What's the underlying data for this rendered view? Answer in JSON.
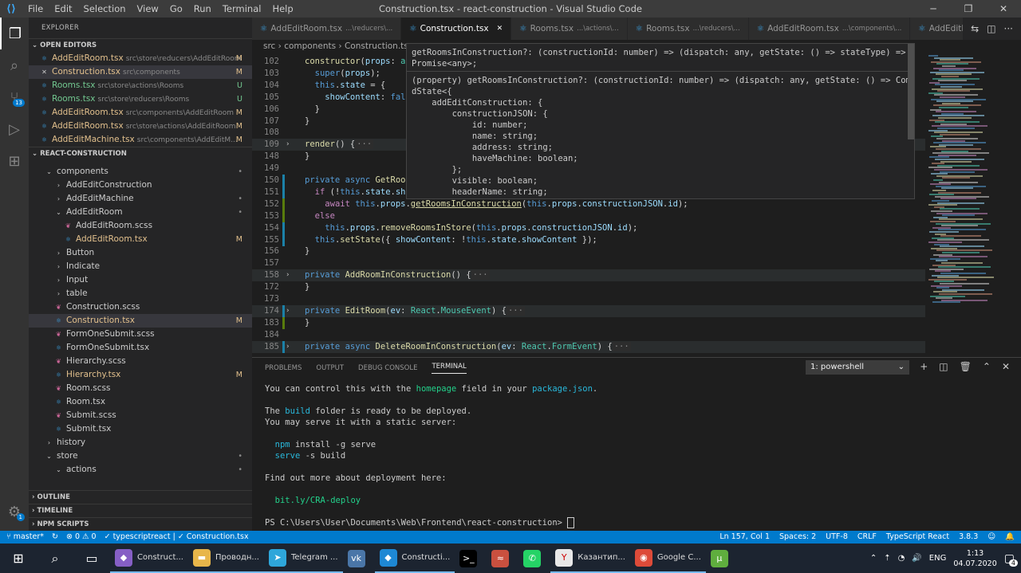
{
  "titlebar": {
    "menu": [
      "File",
      "Edit",
      "Selection",
      "View",
      "Go",
      "Run",
      "Terminal",
      "Help"
    ],
    "title": "Construction.tsx - react-construction - Visual Studio Code"
  },
  "sidebar": {
    "header": "EXPLORER",
    "open_editors_title": "OPEN EDITORS",
    "open_editors": [
      {
        "name": "AddEditRoom.tsx",
        "path": "src\\store\\reducers\\AddEditRoom",
        "status": "M"
      },
      {
        "name": "Construction.tsx",
        "path": "src\\components",
        "status": "M"
      },
      {
        "name": "Rooms.tsx",
        "path": "src\\store\\actions\\Rooms",
        "status": "U"
      },
      {
        "name": "Rooms.tsx",
        "path": "src\\store\\reducers\\Rooms",
        "status": "U"
      },
      {
        "name": "AddEditRoom.tsx",
        "path": "src\\components\\AddEditRoom",
        "status": "M"
      },
      {
        "name": "AddEditRoom.tsx",
        "path": "src\\store\\actions\\AddEditRoom",
        "status": "M"
      },
      {
        "name": "AddEditMachine.tsx",
        "path": "src\\components\\AddEditM...",
        "status": "M"
      }
    ],
    "project_title": "REACT-CONSTRUCTION",
    "tree": [
      {
        "name": "components",
        "kind": "folder-open",
        "indent": 1,
        "status": "•"
      },
      {
        "name": "AddEditConstruction",
        "kind": "folder",
        "indent": 2,
        "status": ""
      },
      {
        "name": "AddEditMachine",
        "kind": "folder",
        "indent": 2,
        "status": "•"
      },
      {
        "name": "AddEditRoom",
        "kind": "folder-open",
        "indent": 2,
        "status": "•"
      },
      {
        "name": "AddEditRoom.scss",
        "kind": "scss",
        "indent": 3,
        "status": ""
      },
      {
        "name": "AddEditRoom.tsx",
        "kind": "ts",
        "indent": 3,
        "status": "M"
      },
      {
        "name": "Button",
        "kind": "folder",
        "indent": 2,
        "status": ""
      },
      {
        "name": "Indicate",
        "kind": "folder",
        "indent": 2,
        "status": ""
      },
      {
        "name": "Input",
        "kind": "folder",
        "indent": 2,
        "status": ""
      },
      {
        "name": "table",
        "kind": "folder",
        "indent": 2,
        "status": ""
      },
      {
        "name": "Construction.scss",
        "kind": "scss",
        "indent": 2,
        "status": ""
      },
      {
        "name": "Construction.tsx",
        "kind": "ts",
        "indent": 2,
        "status": "M"
      },
      {
        "name": "FormOneSubmit.scss",
        "kind": "scss",
        "indent": 2,
        "status": ""
      },
      {
        "name": "FormOneSubmit.tsx",
        "kind": "ts",
        "indent": 2,
        "status": ""
      },
      {
        "name": "Hierarchy.scss",
        "kind": "scss",
        "indent": 2,
        "status": ""
      },
      {
        "name": "Hierarchy.tsx",
        "kind": "ts",
        "indent": 2,
        "status": "M"
      },
      {
        "name": "Room.scss",
        "kind": "scss",
        "indent": 2,
        "status": ""
      },
      {
        "name": "Room.tsx",
        "kind": "ts",
        "indent": 2,
        "status": ""
      },
      {
        "name": "Submit.scss",
        "kind": "scss",
        "indent": 2,
        "status": ""
      },
      {
        "name": "Submit.tsx",
        "kind": "ts",
        "indent": 2,
        "status": ""
      },
      {
        "name": "history",
        "kind": "folder",
        "indent": 1,
        "status": ""
      },
      {
        "name": "store",
        "kind": "folder-open",
        "indent": 1,
        "status": "•"
      },
      {
        "name": "actions",
        "kind": "folder-open",
        "indent": 2,
        "status": "•"
      }
    ],
    "bottom_sections": [
      "OUTLINE",
      "TIMELINE",
      "NPM SCRIPTS"
    ]
  },
  "tabs": [
    {
      "name": "AddEditRoom.tsx",
      "path": "...\\reducers\\...",
      "active": false
    },
    {
      "name": "Construction.tsx",
      "path": "",
      "active": true
    },
    {
      "name": "Rooms.tsx",
      "path": "...\\actions\\...",
      "active": false
    },
    {
      "name": "Rooms.tsx",
      "path": "...\\reducers\\...",
      "active": false
    },
    {
      "name": "AddEditRoom.tsx",
      "path": "...\\components\\...",
      "active": false
    },
    {
      "name": "AddEditRoo",
      "path": "",
      "active": false
    }
  ],
  "breadcrumbs": [
    "src",
    "components",
    "Construction.ts"
  ],
  "code_lines": [
    {
      "n": "102",
      "html": "<span class='fn'>constructor</span><span class='pu'>(</span><span class='pr'>props</span><span class='pu'>: </span><span class='ty'>an</span>",
      "fold": "",
      "g": ""
    },
    {
      "n": "103",
      "html": "  <span class='kw'>super</span><span class='pu'>(</span><span class='pr'>props</span><span class='pu'>);</span>",
      "fold": "",
      "g": ""
    },
    {
      "n": "104",
      "html": "  <span class='kw'>this</span><span class='pu'>.</span><span class='pr'>state</span><span class='pu'> = {</span>",
      "fold": "",
      "g": ""
    },
    {
      "n": "105",
      "html": "    <span class='pr'>showContent</span><span class='pu'>: </span><span class='kw'>fals</span>",
      "fold": "",
      "g": ""
    },
    {
      "n": "106",
      "html": "  <span class='pu'>}</span>",
      "fold": "",
      "g": ""
    },
    {
      "n": "107",
      "html": "<span class='pu'>}</span>",
      "fold": "",
      "g": ""
    },
    {
      "n": "108",
      "html": "",
      "fold": "",
      "g": ""
    },
    {
      "n": "109",
      "html": "<span class='fn'>render</span><span class='pu'>() {</span><span class='foldbox'>···</span>",
      "fold": "›",
      "g": "",
      "hl": true
    },
    {
      "n": "148",
      "html": "<span class='pu'>}</span>",
      "fold": "",
      "g": ""
    },
    {
      "n": "149",
      "html": "",
      "fold": "",
      "g": ""
    },
    {
      "n": "150",
      "html": "<span class='kw'>private</span> <span class='kw'>async</span> <span class='fn'>GetRoom</span>",
      "fold": "",
      "g": "#1b81a8"
    },
    {
      "n": "151",
      "html": "  <span class='ctl'>if</span> <span class='pu'>(!</span><span class='kw'>this</span><span class='pu'>.</span><span class='pr'>state</span><span class='pu'>.</span><span class='pr'>sho</span>",
      "fold": "",
      "g": "#1b81a8"
    },
    {
      "n": "152",
      "html": "    <span class='ctl'>await</span> <span class='kw'>this</span><span class='pu'>.</span><span class='pr'>props</span><span class='pu'>.</span><span class='fn' style='text-decoration:underline'>getRoomsInConstruction</span><span class='pu'>(</span><span class='kw'>this</span><span class='pu'>.</span><span class='pr'>props</span><span class='pu'>.</span><span class='pr'>constructionJSON</span><span class='pu'>.</span><span class='pr'>id</span><span class='pu'>);</span>",
      "fold": "",
      "g": "#587c0c"
    },
    {
      "n": "153",
      "html": "  <span class='ctl'>else</span>",
      "fold": "",
      "g": "#587c0c"
    },
    {
      "n": "154",
      "html": "    <span class='kw'>this</span><span class='pu'>.</span><span class='pr'>props</span><span class='pu'>.</span><span class='fn'>removeRoomsInStore</span><span class='pu'>(</span><span class='kw'>this</span><span class='pu'>.</span><span class='pr'>props</span><span class='pu'>.</span><span class='pr'>constructionJSON</span><span class='pu'>.</span><span class='pr'>id</span><span class='pu'>);</span>",
      "fold": "",
      "g": "#1b81a8"
    },
    {
      "n": "155",
      "html": "  <span class='kw'>this</span><span class='pu'>.</span><span class='fn'>setState</span><span class='pu'>({ </span><span class='pr'>showContent</span><span class='pu'>: !</span><span class='kw'>this</span><span class='pu'>.</span><span class='pr'>state</span><span class='pu'>.</span><span class='pr'>showContent</span><span class='pu'> });</span>",
      "fold": "",
      "g": "#1b81a8"
    },
    {
      "n": "156",
      "html": "<span class='pu'>}</span>",
      "fold": "",
      "g": ""
    },
    {
      "n": "157",
      "html": "",
      "fold": "",
      "g": ""
    },
    {
      "n": "158",
      "html": "<span class='kw'>private</span> <span class='fn'>AddRoomInConstruction</span><span class='pu'>() {</span><span class='foldbox'>···</span>",
      "fold": "›",
      "g": "",
      "hl": true
    },
    {
      "n": "172",
      "html": "<span class='pu'>}</span>",
      "fold": "",
      "g": ""
    },
    {
      "n": "173",
      "html": "",
      "fold": "",
      "g": ""
    },
    {
      "n": "174",
      "html": "<span class='kw'>private</span> <span class='fn'>EditRoom</span><span class='pu'>(</span><span class='pr'>ev</span><span class='pu'>: </span><span class='ty'>React</span><span class='pu'>.</span><span class='ty'>MouseEvent</span><span class='pu'>) {</span><span class='foldbox'>···</span>",
      "fold": "›",
      "g": "#1b81a8",
      "hl": true
    },
    {
      "n": "183",
      "html": "<span class='pu'>}</span>",
      "fold": "",
      "g": "#587c0c"
    },
    {
      "n": "184",
      "html": "",
      "fold": "",
      "g": ""
    },
    {
      "n": "185",
      "html": "<span class='kw'>private</span> <span class='kw'>async</span> <span class='fn'>DeleteRoomInConstruction</span><span class='pu'>(</span><span class='pr'>ev</span><span class='pu'>: </span><span class='ty'>React</span><span class='pu'>.</span><span class='ty'>FormEvent</span><span class='pu'>) {</span><span class='foldbox'>···</span>",
      "fold": "›",
      "g": "#1b81a8",
      "hl": true
    }
  ],
  "hover": {
    "signature": "getRoomsInConstruction?: (constructionId: number) => (dispatch: any, getState: () => stateType) => Promise<any>;",
    "doc": "(property) getRoomsInConstruction?: (constructionId: number) => (dispatch: any, getState: () => Combine\ndState<{\n    addEditConstruction: {\n        constructionJSON: {\n            id: number;\n            name: string;\n            address: string;\n            haveMachine: boolean;\n        };\n        visible: boolean;\n        headerName: string;"
  },
  "panel": {
    "tabs": [
      "PROBLEMS",
      "OUTPUT",
      "DEBUG CONSOLE",
      "TERMINAL"
    ],
    "active_tab": "TERMINAL",
    "terminal_select": "1: powershell"
  },
  "terminal_lines": [
    {
      "html": "You can control this with the <span class='tg'>homepage</span> field in your <span class='tc'>package.json</span>."
    },
    {
      "html": ""
    },
    {
      "html": "The <span class='tc'>build</span> folder is ready to be deployed."
    },
    {
      "html": "You may serve it with a static server:"
    },
    {
      "html": ""
    },
    {
      "html": "  <span class='tc'>npm</span> install -g serve"
    },
    {
      "html": "  <span class='tc'>serve</span> -s build"
    },
    {
      "html": ""
    },
    {
      "html": "Find out more about deployment here:"
    },
    {
      "html": ""
    },
    {
      "html": "  <span class='tg'>bit.ly/CRA-deploy</span>"
    },
    {
      "html": ""
    },
    {
      "html": "PS C:\\Users\\User\\Documents\\Web\\Frontend\\react-construction> <span style='border:1px solid #ccc'>&nbsp;</span>"
    }
  ],
  "statusbar": {
    "branch": "master*",
    "sync": "↻",
    "errors": "⊗ 0 ⚠ 0",
    "lang_ver": "✓ typescriptreact | ✓ Construction.tsx",
    "position": "Ln 157, Col 1",
    "spaces": "Spaces: 2",
    "encoding": "UTF-8",
    "eol": "CRLF",
    "language": "TypeScript React",
    "ts_version": "3.8.3"
  },
  "taskbar": {
    "apps": [
      {
        "label": "Construct...",
        "color": "#865fc5",
        "glyph": "◆",
        "open": true
      },
      {
        "label": "Проводн...",
        "color": "#e8b64a",
        "glyph": "▬",
        "open": true
      },
      {
        "label": "Telegram ...",
        "color": "#2ea6da",
        "glyph": "➤",
        "open": true
      },
      {
        "label": "",
        "color": "#4a76a8",
        "glyph": "vk",
        "open": false
      },
      {
        "label": "Constructi...",
        "color": "#1e88d4",
        "glyph": "◆",
        "open": true
      },
      {
        "label": "",
        "color": "#000000",
        "glyph": ">_",
        "open": false
      },
      {
        "label": "",
        "color": "#c9503f",
        "glyph": "≈",
        "open": false
      },
      {
        "label": "",
        "color": "#25d366",
        "glyph": "✆",
        "open": false
      },
      {
        "label": "Казантип...",
        "color": "#e8e8e8",
        "glyph": "Y",
        "open": true
      },
      {
        "label": "Google C...",
        "color": "#dd4b39",
        "glyph": "◉",
        "open": true
      },
      {
        "label": "",
        "color": "#5fae3e",
        "glyph": "µ",
        "open": false
      }
    ],
    "tray_lang": "ENG",
    "time": "1:13",
    "date": "04.07.2020",
    "notifications": "4"
  }
}
